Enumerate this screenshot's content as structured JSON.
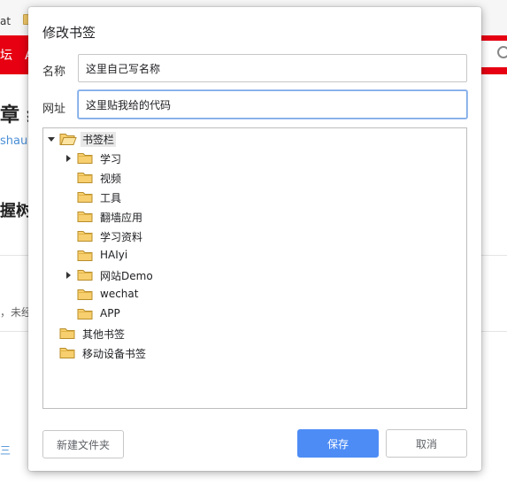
{
  "background_page": {
    "tab_fragment": "at",
    "redbar_fragment": "坛　A",
    "heading_fragment": "章 纟",
    "author_fragment": "shau",
    "subheading_fragment": "握树",
    "note_fragment": "，未经",
    "link_fragment": "三"
  },
  "dialog": {
    "title": "修改书签",
    "name_label": "名称",
    "name_value": "这里自己写名称",
    "url_label": "网址",
    "url_value": "这里贴我给的代码",
    "tree": [
      {
        "label": "书签栏",
        "expanded": true,
        "selected": true
      },
      {
        "label": "学习",
        "has_children": true
      },
      {
        "label": "视频"
      },
      {
        "label": "工具"
      },
      {
        "label": "翻墙应用"
      },
      {
        "label": "学习资料"
      },
      {
        "label": "HAIyi"
      },
      {
        "label": "网站Demo",
        "has_children": true
      },
      {
        "label": "wechat"
      },
      {
        "label": "APP"
      },
      {
        "label": "其他书签"
      },
      {
        "label": "移动设备书签"
      }
    ],
    "new_folder_label": "新建文件夹",
    "save_label": "保存",
    "cancel_label": "取消"
  },
  "colors": {
    "accent": "#4d8cf5",
    "focus_ring": "#7aa7e6",
    "site_red": "#e60012",
    "folder_fill": "#f7cf6f"
  }
}
